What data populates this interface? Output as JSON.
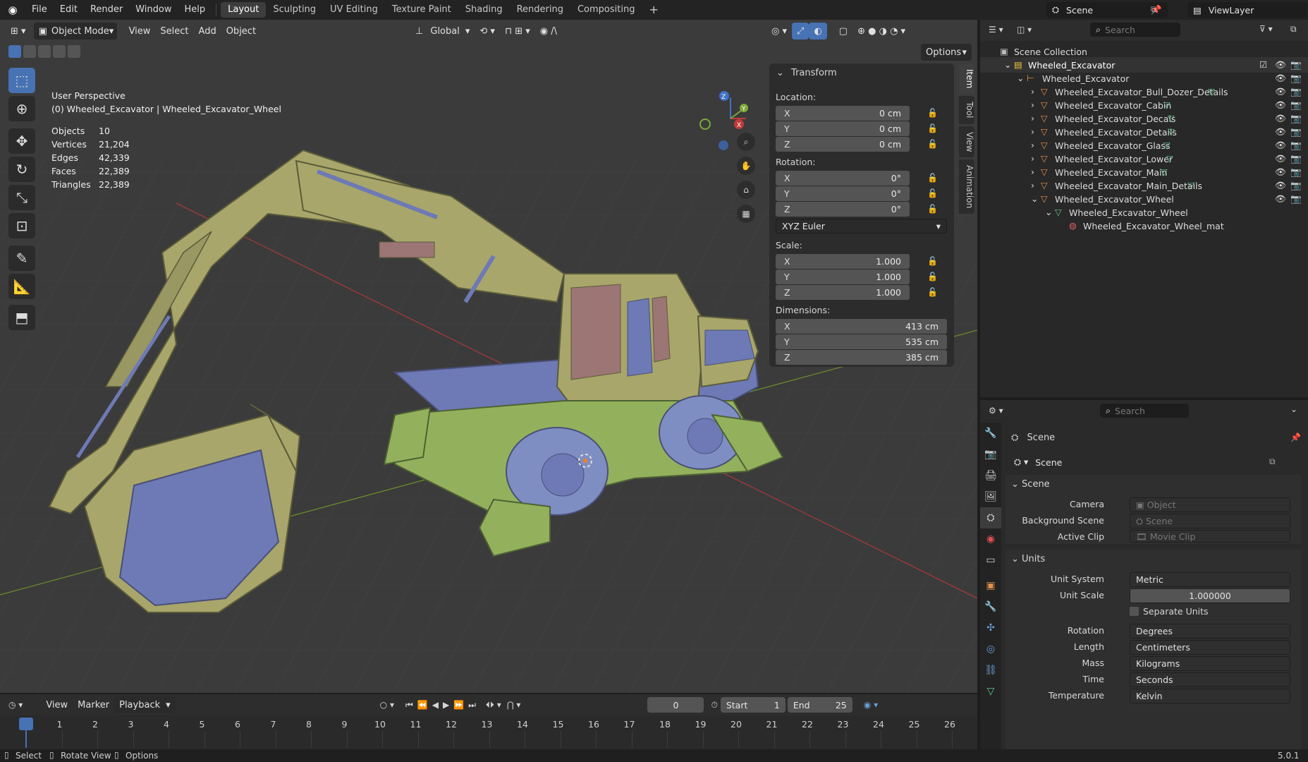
{
  "topbar": {
    "menus": [
      "File",
      "Edit",
      "Render",
      "Window",
      "Help"
    ],
    "workspaces": [
      "Layout",
      "Sculpting",
      "UV Editing",
      "Texture Paint",
      "Shading",
      "Rendering",
      "Compositing"
    ],
    "active_workspace": "Layout",
    "add_tab": "+",
    "scene": "Scene",
    "view_layer": "ViewLayer"
  },
  "viewport_header": {
    "mode": "Object Mode",
    "menus": [
      "View",
      "Select",
      "Add",
      "Object"
    ],
    "orientation": "Global",
    "options": "Options"
  },
  "viewport": {
    "view_name": "User Perspective",
    "active": "(0) Wheeled_Excavator | Wheeled_Excavator_Wheel",
    "stats": [
      {
        "label": "Objects",
        "value": "10"
      },
      {
        "label": "Vertices",
        "value": "21,204"
      },
      {
        "label": "Edges",
        "value": "42,339"
      },
      {
        "label": "Faces",
        "value": "22,389"
      },
      {
        "label": "Triangles",
        "value": "22,389"
      }
    ],
    "gizmo": {
      "x": "X",
      "y": "Y",
      "z": "Z"
    }
  },
  "npanel": {
    "title": "Transform",
    "location_label": "Location:",
    "location": [
      {
        "axis": "X",
        "value": "0 cm"
      },
      {
        "axis": "Y",
        "value": "0 cm"
      },
      {
        "axis": "Z",
        "value": "0 cm"
      }
    ],
    "rotation_label": "Rotation:",
    "rotation": [
      {
        "axis": "X",
        "value": "0°"
      },
      {
        "axis": "Y",
        "value": "0°"
      },
      {
        "axis": "Z",
        "value": "0°"
      }
    ],
    "rotation_mode": "XYZ Euler",
    "scale_label": "Scale:",
    "scale": [
      {
        "axis": "X",
        "value": "1.000"
      },
      {
        "axis": "Y",
        "value": "1.000"
      },
      {
        "axis": "Z",
        "value": "1.000"
      }
    ],
    "dimensions_label": "Dimensions:",
    "dimensions": [
      {
        "axis": "X",
        "value": "413 cm"
      },
      {
        "axis": "Y",
        "value": "535 cm"
      },
      {
        "axis": "Z",
        "value": "385 cm"
      }
    ],
    "tabs": [
      "Item",
      "Tool",
      "View",
      "Animation"
    ]
  },
  "outliner": {
    "search_placeholder": "Search",
    "root": "Scene Collection",
    "collection": "Wheeled_Excavator",
    "empty": "Wheeled_Excavator",
    "children": [
      "Wheeled_Excavator_Bull_Dozer_Details",
      "Wheeled_Excavator_Cabin",
      "Wheeled_Excavator_Decals",
      "Wheeled_Excavator_Details",
      "Wheeled_Excavator_Glass",
      "Wheeled_Excavator_Lower",
      "Wheeled_Excavator_Main",
      "Wheeled_Excavator_Main_Details",
      "Wheeled_Excavator_Wheel"
    ],
    "mesh": "Wheeled_Excavator_Wheel",
    "material": "Wheeled_Excavator_Wheel_mat"
  },
  "properties": {
    "search_placeholder": "Search",
    "context": "Scene",
    "datablock": "Scene",
    "scene_panel": "Scene",
    "camera_label": "Camera",
    "camera_placeholder": "Object",
    "bg_scene_label": "Background Scene",
    "bg_scene_placeholder": "Scene",
    "active_clip_label": "Active Clip",
    "active_clip_placeholder": "Movie Clip",
    "units_panel": "Units",
    "unit_system_label": "Unit System",
    "unit_system": "Metric",
    "unit_scale_label": "Unit Scale",
    "unit_scale": "1.000000",
    "separate_units": "Separate Units",
    "rotation_label": "Rotation",
    "rotation": "Degrees",
    "length_label": "Length",
    "length": "Centimeters",
    "mass_label": "Mass",
    "mass": "Kilograms",
    "time_label": "Time",
    "time": "Seconds",
    "temperature_label": "Temperature",
    "temperature": "Kelvin"
  },
  "timeline": {
    "menus": [
      "View",
      "Marker"
    ],
    "playback": "Playback",
    "current_frame": "0",
    "start_label": "Start",
    "start": "1",
    "end_label": "End",
    "end": "25",
    "ticks": [
      "0",
      "1",
      "2",
      "3",
      "4",
      "5",
      "6",
      "7",
      "8",
      "9",
      "10",
      "11",
      "12",
      "13",
      "14",
      "15",
      "16",
      "17",
      "18",
      "19",
      "20",
      "21",
      "22",
      "23",
      "24",
      "25",
      "26"
    ]
  },
  "statusbar": {
    "select": "Select",
    "rotate": "Rotate View",
    "options": "Options",
    "version": "5.0.1"
  },
  "colors": {
    "accent": "#4772b3",
    "viewport": "#3a3a3a",
    "panel": "#2c2c2c",
    "excavator_body": "#a8a66a",
    "excavator_blue": "#6d7ab5"
  }
}
